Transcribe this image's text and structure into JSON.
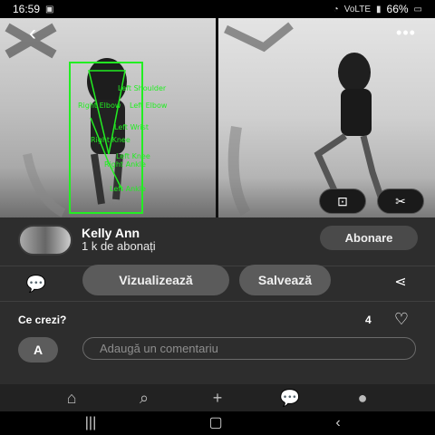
{
  "status_bar": {
    "time": "16:59",
    "battery": "66%",
    "network": "VoLTE"
  },
  "header": {
    "back_icon": "back-arrow-icon",
    "more_icon": "more-dots-icon"
  },
  "pose_labels": [
    "Left Shoulder",
    "Right Elbow",
    "Left Elbow",
    "Left Wrist",
    "Right Knee",
    "Left Knee",
    "Right Ankle",
    "Left Ankle"
  ],
  "image_actions": {
    "lens_icon": "lens-search-icon",
    "scissors_icon": "scissors-icon"
  },
  "author": {
    "name": "Kelly Ann",
    "followers": "1 k de abonați",
    "follow_label": "Abonare"
  },
  "actions": {
    "view_label": "Vizualizează",
    "save_label": "Salvează"
  },
  "comments": {
    "question": "Ce crezi?",
    "like_count": "4",
    "user_initial": "A",
    "placeholder": "Adaugă un comentariu"
  },
  "tabs": [
    {
      "name": "home",
      "icon": "home-icon"
    },
    {
      "name": "search",
      "icon": "search-icon"
    },
    {
      "name": "create",
      "icon": "plus-icon"
    },
    {
      "name": "messages",
      "icon": "chat-icon"
    },
    {
      "name": "profile",
      "icon": "profile-icon"
    }
  ],
  "colors": {
    "pose_green": "#22ee22",
    "panel_bg": "#2d2d2d",
    "pill_bg": "#5b5b5b"
  }
}
